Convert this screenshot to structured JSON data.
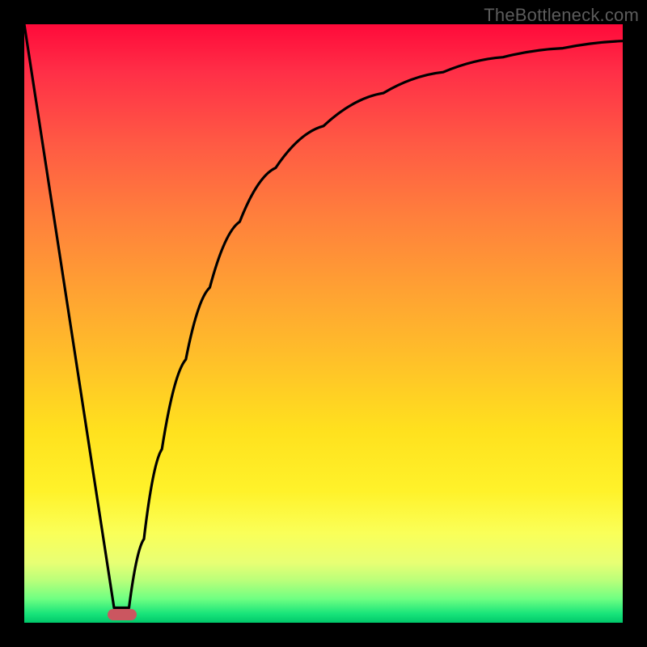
{
  "watermark": "TheBottleneck.com",
  "colors": {
    "frame": "#000000",
    "curve": "#000000",
    "marker": "#cb5660",
    "gradient_stops": [
      "#ff0a3a",
      "#ff2f47",
      "#ff5a44",
      "#ff7f3c",
      "#ffa033",
      "#ffc029",
      "#ffe11e",
      "#fff22a",
      "#faff58",
      "#e8ff74",
      "#b8ff7a",
      "#6fff82",
      "#18e47a",
      "#00c76a"
    ]
  },
  "chart_data": {
    "type": "line",
    "title": "",
    "xlabel": "",
    "ylabel": "",
    "xlim": [
      0,
      1
    ],
    "ylim": [
      0,
      1
    ],
    "note": "Axes are unlabeled; values are normalized positions read from the image. Higher y = higher on the plot (top=1).",
    "series": [
      {
        "name": "left-falling-line",
        "x": [
          0.0,
          0.02,
          0.05,
          0.08,
          0.1,
          0.12,
          0.14,
          0.15
        ],
        "y": [
          1.0,
          0.87,
          0.675,
          0.48,
          0.35,
          0.22,
          0.09,
          0.025
        ]
      },
      {
        "name": "right-rising-curve",
        "x": [
          0.175,
          0.2,
          0.23,
          0.27,
          0.31,
          0.36,
          0.42,
          0.5,
          0.6,
          0.7,
          0.8,
          0.9,
          1.0
        ],
        "y": [
          0.025,
          0.14,
          0.29,
          0.44,
          0.56,
          0.67,
          0.76,
          0.83,
          0.885,
          0.92,
          0.945,
          0.96,
          0.972
        ]
      }
    ],
    "marker": {
      "x": 0.163,
      "y": 0.013,
      "shape": "rounded-bar"
    }
  }
}
